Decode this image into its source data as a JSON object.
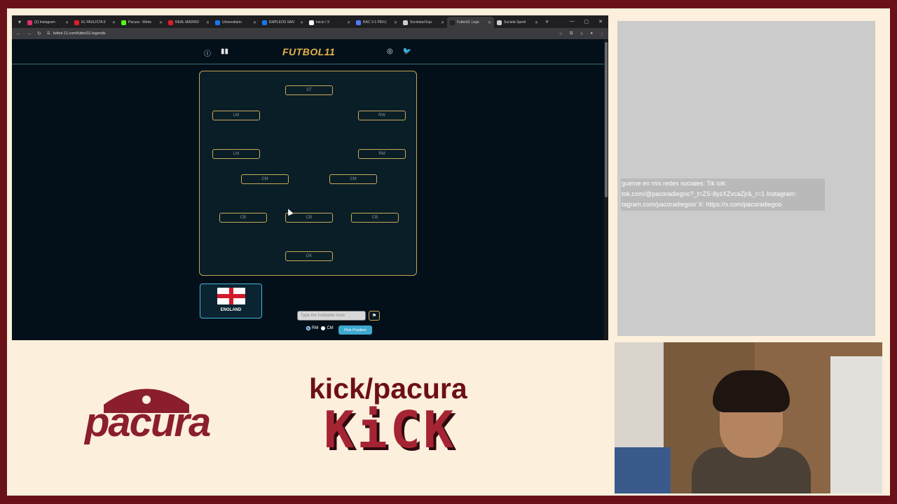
{
  "browser": {
    "tabs": [
      {
        "label": "(2) Instagram",
        "color": "#e1306c"
      },
      {
        "label": "EL PAULISTA II",
        "color": "#e11d2b"
      },
      {
        "label": "Pacura - Webs",
        "color": "#53fc18"
      },
      {
        "label": "REAL MADRID",
        "color": "#e11d2b"
      },
      {
        "label": "Universitario",
        "color": "#1877f2"
      },
      {
        "label": "EMPLEOS SAN",
        "color": "#1877f2"
      },
      {
        "label": "Inicio / X",
        "color": "#ffffff"
      },
      {
        "label": "RAC 3-1 PEN |",
        "color": "#4f7cff"
      },
      {
        "label": "Sociedad Esp",
        "color": "#cccccc"
      },
      {
        "label": "Futbol11 Lege",
        "color": "#222222"
      },
      {
        "label": "Società Sporti",
        "color": "#cccccc"
      }
    ],
    "url": "futbol-11.com/futbol11-legends"
  },
  "site": {
    "logo": "FUTBOL11",
    "positions": {
      "st": "ST",
      "lw": "LW",
      "rw": "RW",
      "lm": "LM",
      "rm": "RM",
      "cm_left": "CM",
      "cm_right": "CM",
      "cb_left": "CB",
      "cb_mid": "CB",
      "cb_right": "CB",
      "gk": "GK"
    },
    "nation": "ENGLAND",
    "input_placeholder": "Type the footballer here",
    "radio_1": "RM",
    "radio_2": "CM",
    "pick_button": "Pick Position"
  },
  "overlay": {
    "ticker_lines": [
      "gueme en mis redes sociales: Tik tok:",
      "tok.com/@pacoradiegoo?_t=ZS-8yzXZvcaZjr&_r=1 Instagram:",
      "tagram.com/pacoradiegoo/ X: https://x.com/pacoradiegoo"
    ],
    "brand": "pacura",
    "kick_handle": "kick/pacura",
    "kick_word": "KiCK"
  },
  "colors": {
    "frame": "#6a1019",
    "background": "#fcefdc",
    "pitch_border": "#c4a455",
    "accent": "#3fa9cf",
    "logo_gold": "#e4b34a"
  }
}
